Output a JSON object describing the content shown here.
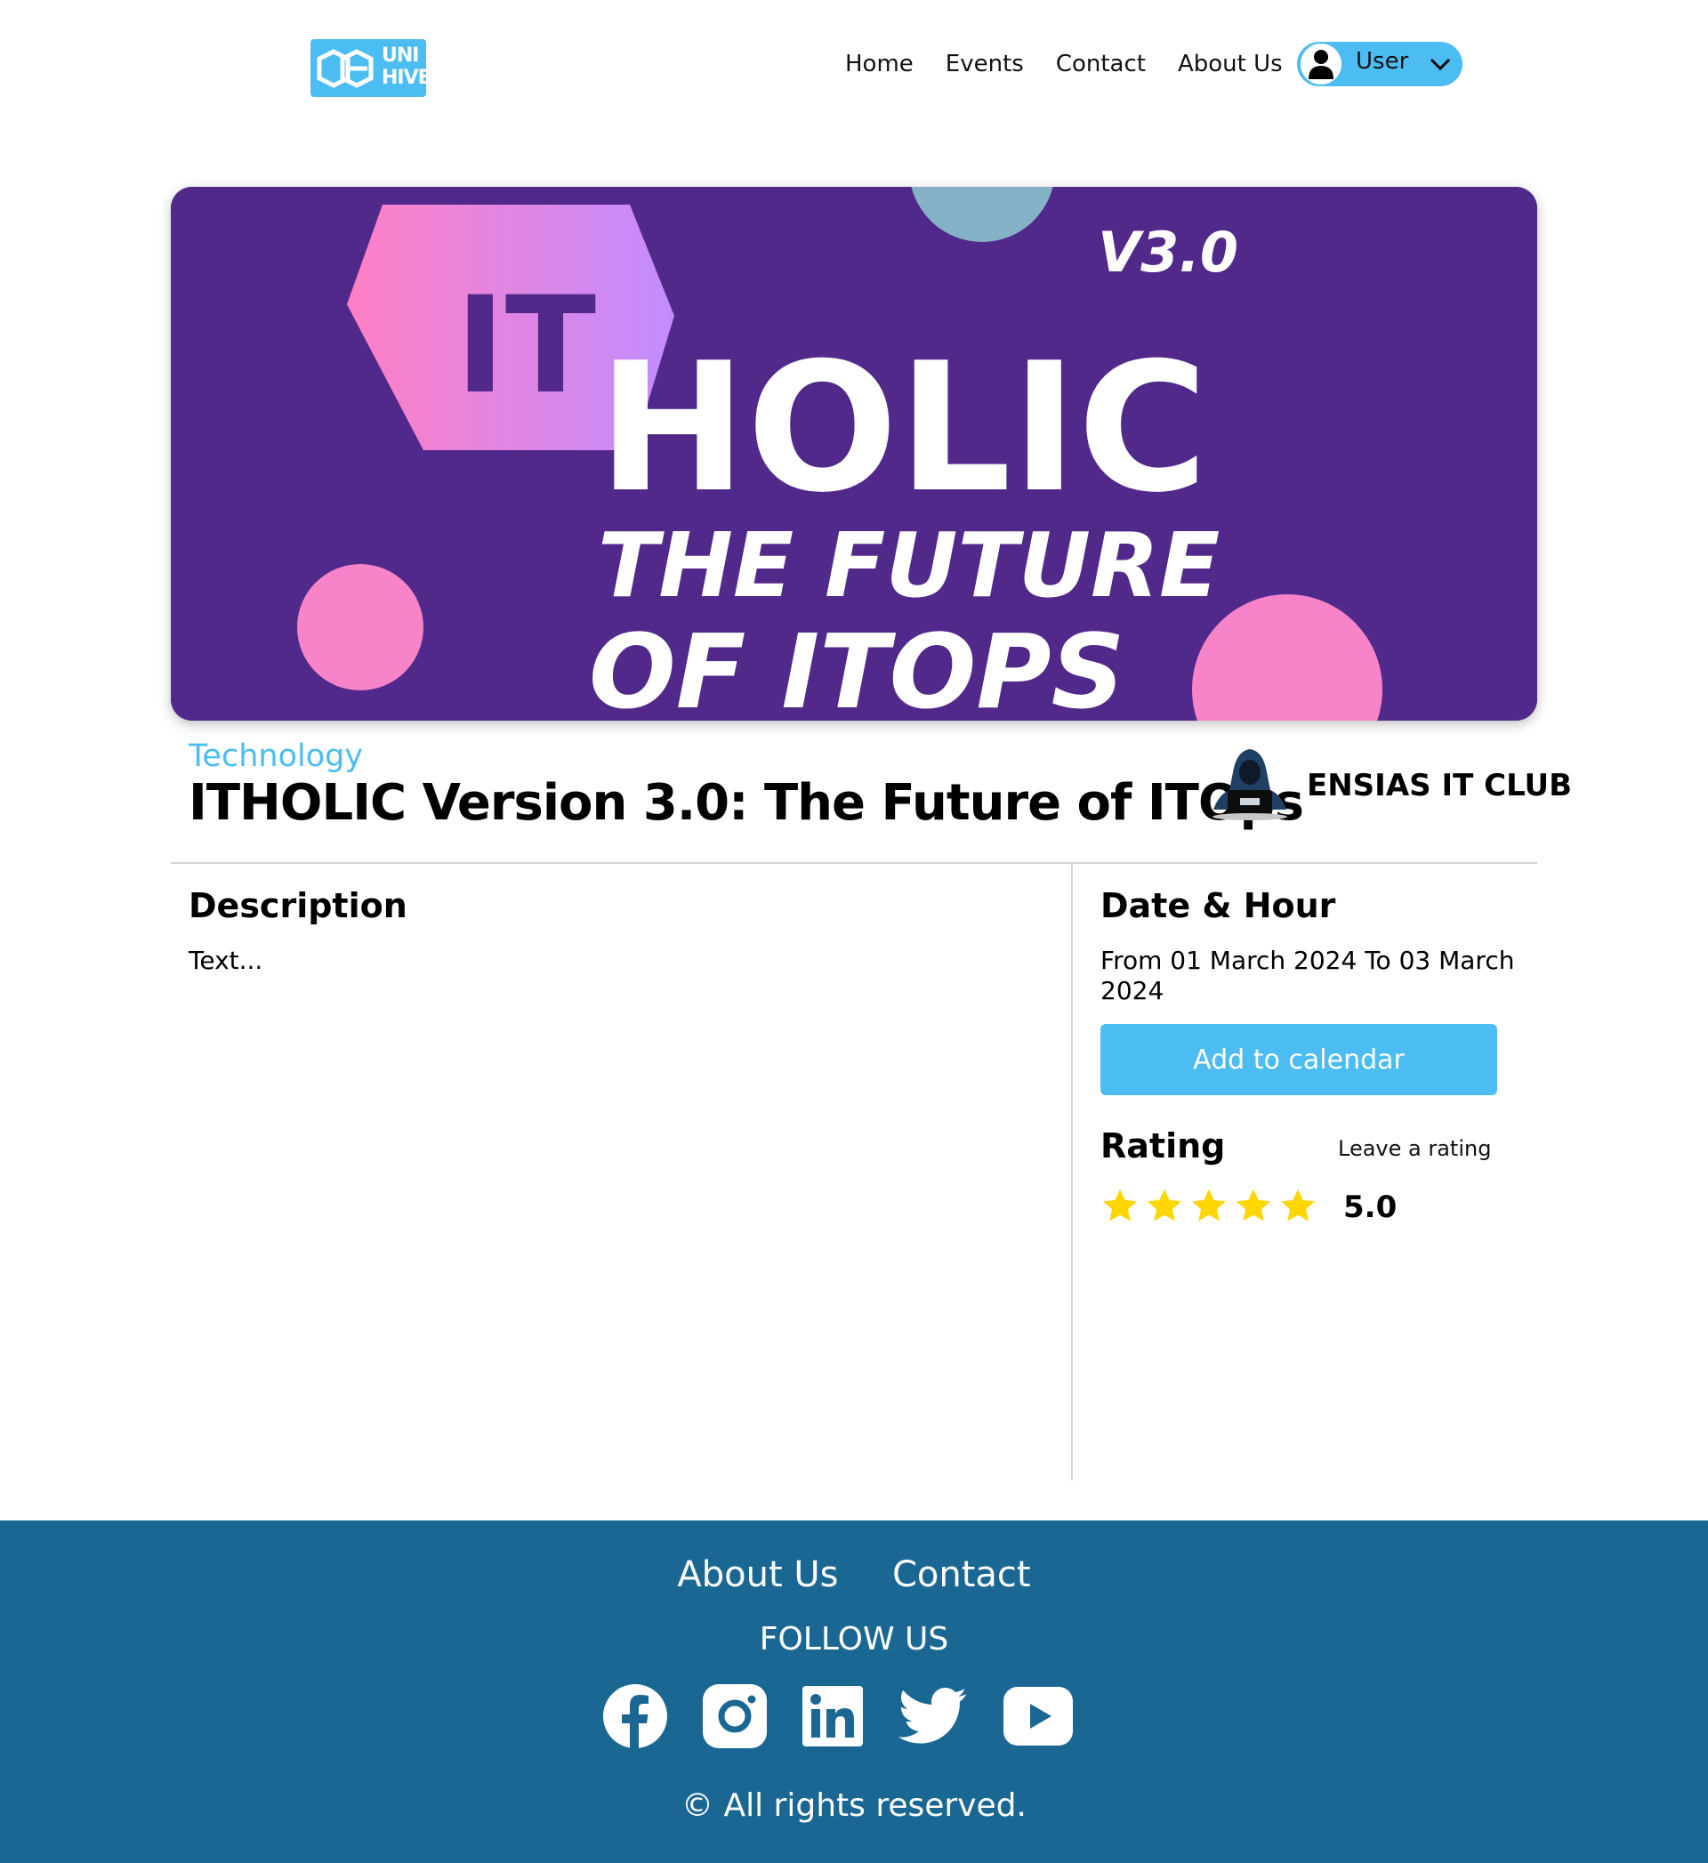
{
  "header": {
    "logo_text_line1": "UNI",
    "logo_text_line2": "HIVE",
    "nav": [
      "Home",
      "Events",
      "Contact",
      "About Us"
    ],
    "user_label": "User"
  },
  "event": {
    "category": "Technology",
    "title": "ITHOLIC Version 3.0: The Future of ITOps",
    "organizer": "ENSIAS IT CLUB",
    "banner": {
      "badge": "IT",
      "version": "V3.0",
      "word": "HOLIC",
      "tagline_line1": "THE FUTURE",
      "tagline_line2": "OF ITOPS"
    },
    "description_heading": "Description",
    "description_text": "Text...",
    "date_heading": "Date & Hour",
    "date_text": "From 01 March 2024 To 03 March 2024",
    "calendar_button": "Add to calendar",
    "rating_heading": "Rating",
    "leave_rating": "Leave a rating",
    "rating_value": "5.0",
    "stars_filled": 5
  },
  "footer": {
    "links": [
      "About Us",
      "Contact"
    ],
    "follow": "FOLLOW US",
    "socials": [
      "facebook-icon",
      "instagram-icon",
      "linkedin-icon",
      "twitter-icon",
      "youtube-icon"
    ],
    "copyright": "© All rights reserved."
  },
  "colors": {
    "accent": "#4cbdf3",
    "footer": "#1b6794",
    "banner": "#51298a",
    "star": "#ffd600"
  }
}
